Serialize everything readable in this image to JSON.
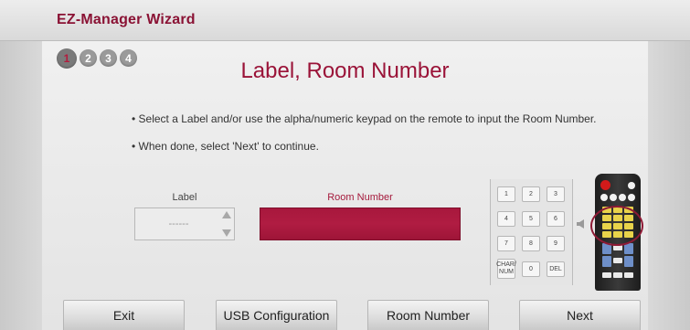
{
  "app_title": "EZ-Manager Wizard",
  "steps": [
    "1",
    "2",
    "3",
    "4"
  ],
  "current_step": "1",
  "page_title": "Label, Room Number",
  "instructions": [
    "• Select a Label and/or use the alpha/numeric keypad on the remote to input the Room Number.",
    "• When done, select 'Next' to continue."
  ],
  "form": {
    "label_caption": "Label",
    "label_value": "------",
    "room_caption": "Room Number",
    "room_value": ""
  },
  "keypad": {
    "keys": [
      "1",
      "2",
      "3",
      "4",
      "5",
      "6",
      "7",
      "8",
      "9",
      "CHAR/ NUM",
      "0",
      "DEL"
    ]
  },
  "icons": {
    "keypad_arrow": "left-arrow-icon",
    "remote": "remote-control-icon"
  },
  "buttons": {
    "exit": "Exit",
    "usb": "USB Configuration",
    "room": "Room Number",
    "next": "Next"
  },
  "colors": {
    "accent": "#9a1338",
    "room_field": "#a8183d"
  }
}
